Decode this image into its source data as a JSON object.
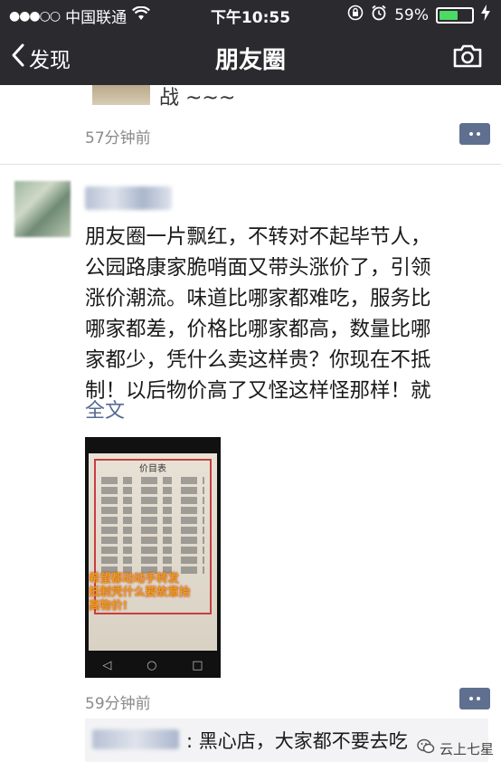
{
  "status_bar": {
    "signal": "●●●○○",
    "carrier": "中国联通",
    "time": "下午10:55",
    "battery_percent": "59%",
    "battery_level": 0.59
  },
  "nav": {
    "back_label": "发现",
    "title": "朋友圈"
  },
  "previous_post": {
    "text_fragment": "战 ~~~",
    "time": "57分钟前"
  },
  "post": {
    "lines": [
      "朋友圈一片飘红，不转对不起毕节人，",
      "公园路康家脆哨面又带头涨价了，引领",
      "涨价潮流。味道比哪家都难吃，服务比",
      "哪家都差，价格比哪家都高，数量比哪",
      "家都少，凭什么卖这样贵？你现在不抵",
      "制！以后物价高了又怪这样怪那样！就"
    ],
    "full_text_label": "全文",
    "image": {
      "menu_title": "价目表",
      "overlay_lines": [
        "希望都动动手转发",
        "抵制凭什么要故意抬",
        "高物价!"
      ]
    },
    "time": "59分钟前"
  },
  "comment": {
    "text": ": 黑心店，大家都不要去吃"
  },
  "watermark": {
    "label": "云上七星"
  }
}
